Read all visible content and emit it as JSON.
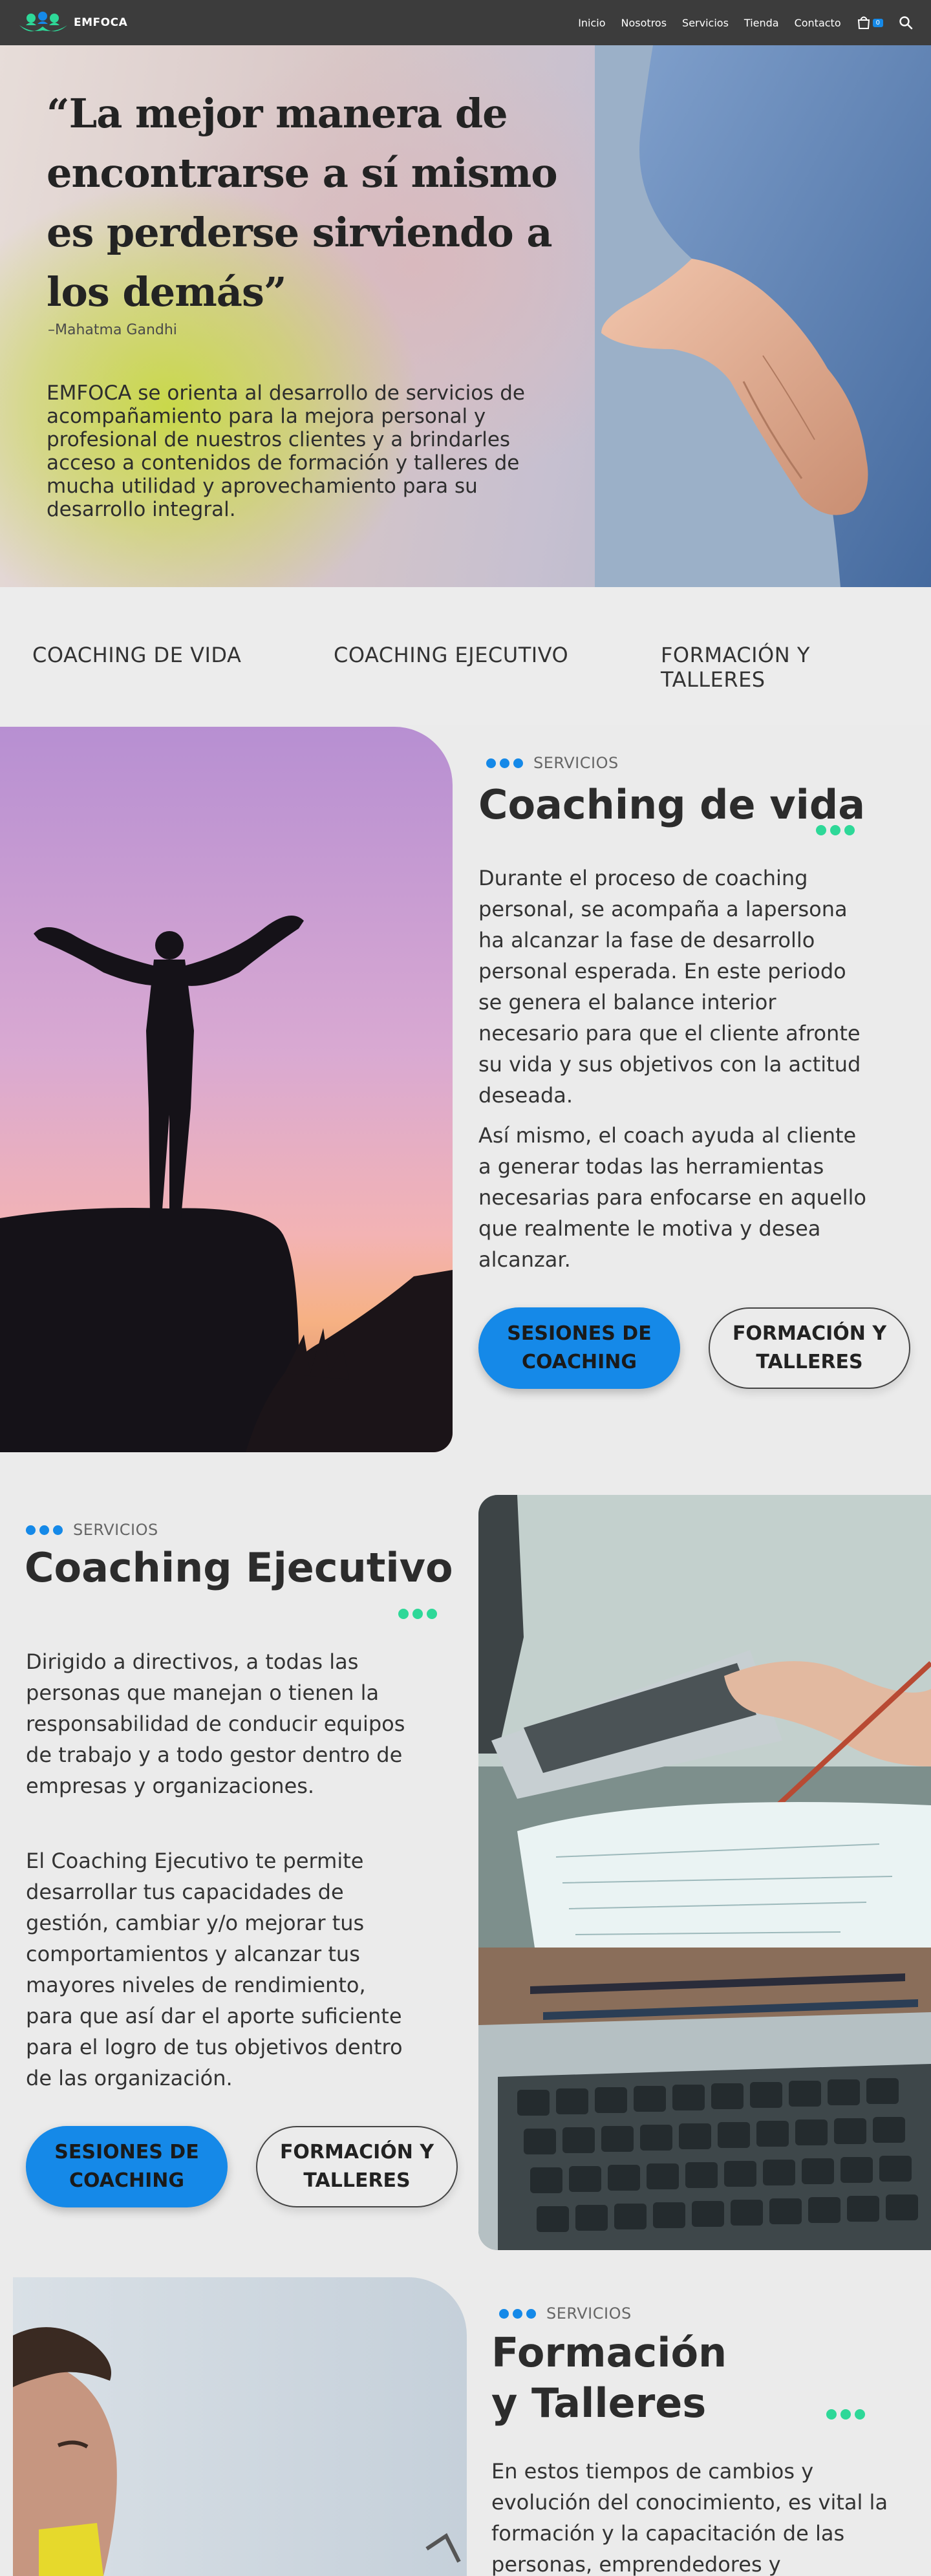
{
  "brand": {
    "name": "EMFOCA"
  },
  "nav": {
    "items": [
      "Inicio",
      "Nosotros",
      "Servicios",
      "Tienda",
      "Contacto"
    ],
    "cart_count": "0"
  },
  "hero": {
    "quote": "“La mejor manera de encontrarse a sí mismo es perderse sirviendo a los demás”",
    "author": "–Mahatma Gandhi",
    "description": "EMFOCA se orienta al desarrollo de servicios de acompañamiento para la mejora personal y profesional de nuestros clientes y a brindarles acceso a contenidos de formación y talleres de mucha utilidad y aprovechamiento para su desarrollo integral."
  },
  "tabs": [
    "COACHING DE VIDA",
    "COACHING EJECUTIVO",
    "FORMACIÓN Y TALLERES"
  ],
  "sections": [
    {
      "eyebrow": "SERVICIOS",
      "title": "Coaching de vida",
      "paragraphs": [
        "Durante el proceso de coaching personal, se acompaña a lapersona ha alcanzar la fase de desarrollo personal esperada. En este periodo se genera el balance interior necesario para que el cliente afronte su vida y sus objetivos con la actitud deseada.",
        "Así mismo, el coach ayuda al cliente a generar todas las herramientas necesarias para enfocarse en aquello que realmente le motiva y desea alcanzar."
      ],
      "btn_primary": "SESIONES DE COACHING",
      "btn_secondary": "FORMACIÓN Y TALLERES"
    },
    {
      "eyebrow": "SERVICIOS",
      "title": "Coaching Ejecutivo",
      "paragraphs": [
        "Dirigido a directivos, a todas las personas que manejan o tienen la responsabilidad de conducir equipos de trabajo y a todo gestor dentro de empresas y organizaciones.",
        "El Coaching Ejecutivo te permite desarrollar tus capacidades de gestión, cambiar y/o mejorar tus comportamientos y alcanzar tus mayores niveles de rendimiento, para que así dar el aporte suficiente para el logro de tus objetivos dentro de las organización."
      ],
      "btn_primary": "SESIONES DE COACHING",
      "btn_secondary": "FORMACIÓN Y TALLERES"
    },
    {
      "eyebrow": "SERVICIOS",
      "title": "Formación y Talleres",
      "paragraphs": [
        "En estos tiempos de cambios y evolución del conocimiento, es vital la formación y la capacitación de las personas, emprendedores y"
      ]
    }
  ],
  "colors": {
    "nav_bg": "#3c3c3c",
    "accent_blue": "#1589e8",
    "accent_green": "#2ed898",
    "page_bg": "#ebebeb"
  }
}
